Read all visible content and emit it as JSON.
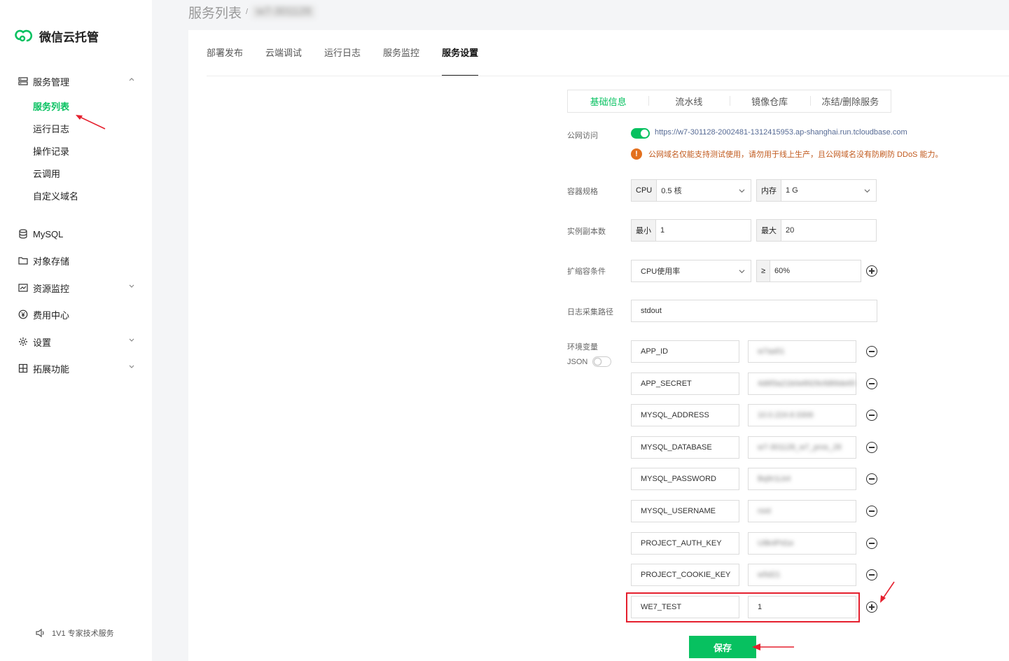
{
  "app": {
    "title": "微信云托管",
    "brand_color": "#07c160"
  },
  "sidebar": {
    "groups": [
      {
        "label": "服务管理",
        "icon": "server-icon",
        "expanded": true
      },
      {
        "label": "MySQL",
        "icon": "database-icon"
      },
      {
        "label": "对象存储",
        "icon": "folder-icon"
      },
      {
        "label": "资源监控",
        "icon": "monitor-icon"
      },
      {
        "label": "费用中心",
        "icon": "yen-icon"
      },
      {
        "label": "设置",
        "icon": "gear-icon"
      },
      {
        "label": "拓展功能",
        "icon": "grid-icon"
      }
    ],
    "sub_items": [
      "服务列表",
      "运行日志",
      "操作记录",
      "云调用",
      "自定义域名"
    ],
    "footer": "1V1 专家技术服务"
  },
  "breadcrumb": {
    "main": "服务列表",
    "sep": "/",
    "service_id": "w7-301128"
  },
  "tabs": [
    "部署发布",
    "云端调试",
    "运行日志",
    "服务监控",
    "服务设置"
  ],
  "sub_tabs": [
    "基础信息",
    "流水线",
    "镜像仓库",
    "冻结/删除服务"
  ],
  "settings": {
    "public_access": {
      "label": "公网访问",
      "url": "https://w7-301128-2002481-1312415953.ap-shanghai.run.tcloudbase.com",
      "warning": "公网域名仅能支持测试使用，请勿用于线上生产，且公网域名没有防刷防 DDoS 能力。"
    },
    "container": {
      "label": "容器规格",
      "cpu_addon": "CPU",
      "cpu_value": "0.5 核",
      "mem_addon": "内存",
      "mem_value": "1 G"
    },
    "replicas": {
      "label": "实例副本数",
      "min_addon": "最小",
      "min_value": "1",
      "max_addon": "最大",
      "max_value": "20"
    },
    "scaling": {
      "label": "扩缩容条件",
      "condition": "CPU使用率",
      "op": "≥",
      "threshold": "60%"
    },
    "log_path": {
      "label": "日志采集路径",
      "value": "stdout"
    },
    "env": {
      "label": "环境变量",
      "json_label": "JSON",
      "vars": [
        {
          "key": "APP_ID",
          "value": "w7aa51"
        },
        {
          "key": "APP_SECRET",
          "value": "4d6f3a21b0e8929cfd89de65"
        },
        {
          "key": "MYSQL_ADDRESS",
          "value": "10.0.224.6:3306"
        },
        {
          "key": "MYSQL_DATABASE",
          "value": "w7-301128_w7_pros_28"
        },
        {
          "key": "MYSQL_PASSWORD",
          "value": "Bq9r1Lk4"
        },
        {
          "key": "MYSQL_USERNAME",
          "value": "root"
        },
        {
          "key": "PROJECT_AUTH_KEY",
          "value": "U8k4Pd1e"
        },
        {
          "key": "PROJECT_COOKIE_KEY",
          "value": "w5d21"
        },
        {
          "key": "WE7_TEST",
          "value": "1"
        }
      ]
    },
    "save_label": "保存"
  },
  "colors": {
    "accent": "#07c160",
    "warning": "#e3701e",
    "link": "#576b95",
    "annotation": "#e5202e"
  }
}
